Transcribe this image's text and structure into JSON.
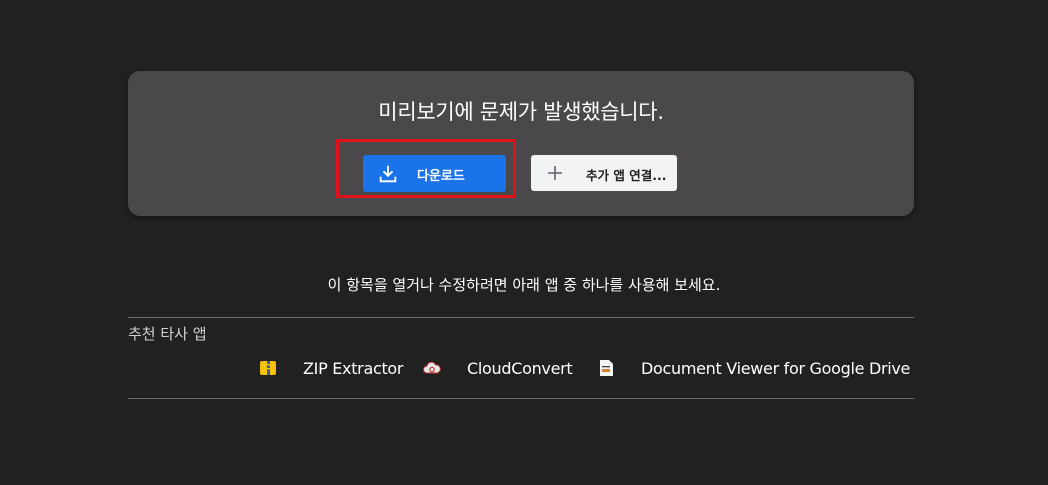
{
  "card": {
    "title": "미리보기에 문제가 발생했습니다.",
    "download_label": "다운로드",
    "connect_label": "추가 앱 연결..."
  },
  "prompt": "이 항목을 열거나 수정하려면 아래 앱 중 하나를 사용해 보세요.",
  "recommended": {
    "title": "추천 타사 앱",
    "apps": [
      {
        "name": "ZIP Extractor",
        "icon": "zip-extractor-icon"
      },
      {
        "name": "CloudConvert",
        "icon": "cloudconvert-icon"
      },
      {
        "name": "Document Viewer for Google Drive",
        "icon": "document-viewer-icon"
      }
    ]
  },
  "colors": {
    "background": "#222122",
    "card": "#4a484b",
    "primary_button": "#1a73e8",
    "highlight": "#e0111b"
  }
}
